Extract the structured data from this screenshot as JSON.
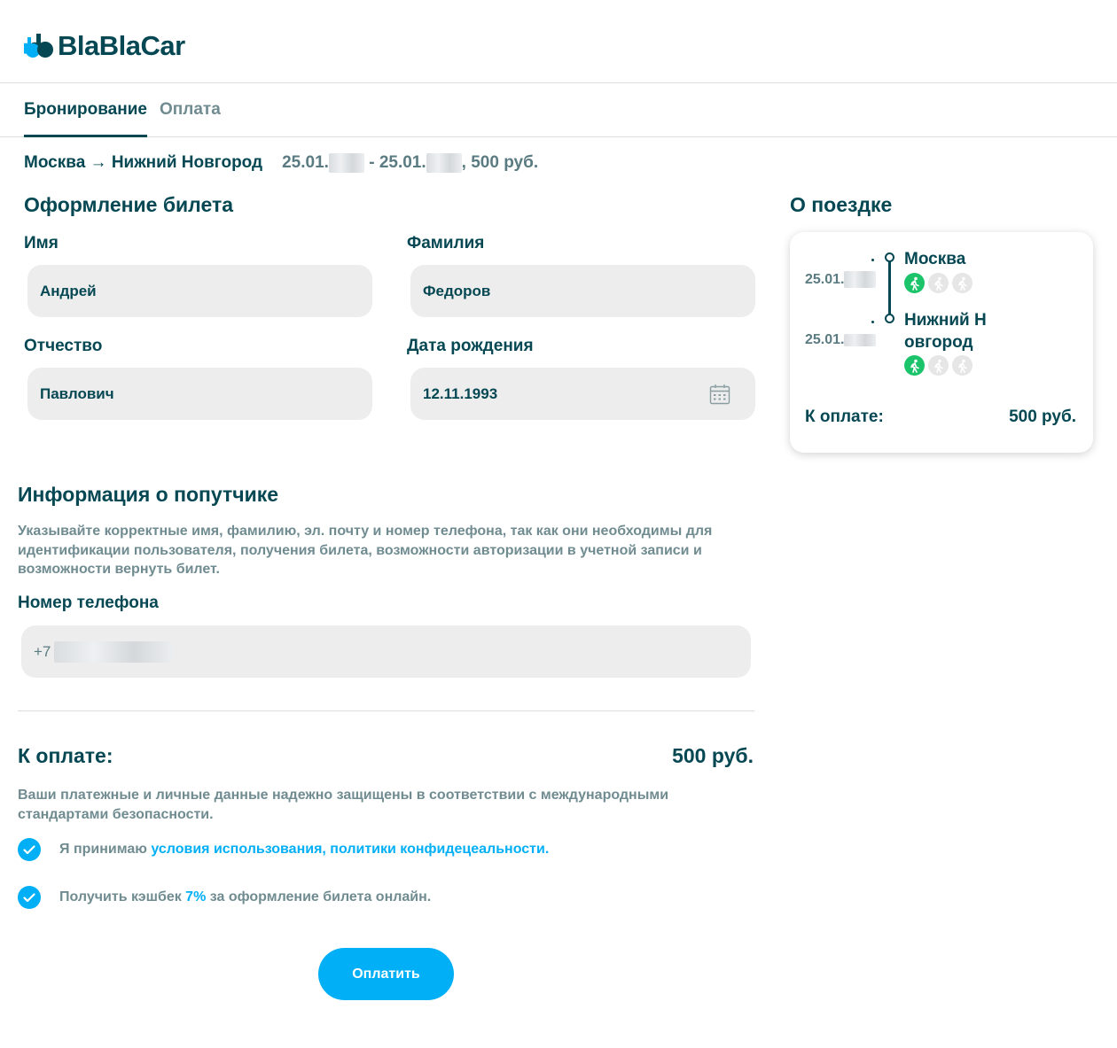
{
  "brand": {
    "name": "BlaBlaCar",
    "color": "#054752",
    "accent": "#00aff5"
  },
  "tabs": [
    {
      "label": "Бронирование",
      "active": true
    },
    {
      "label": "Оплата",
      "active": false
    }
  ],
  "route": {
    "title": "Москва → Нижний Новгород",
    "date_from": "25.01.",
    "date_sep": " - ",
    "date_to": "25.01.",
    "price_suffix": ", 500 руб."
  },
  "ticket_form": {
    "title": "Оформление билета",
    "first_name": {
      "label": "Имя",
      "value": "Андрей"
    },
    "last_name": {
      "label": "Фамилия",
      "value": "Федоров"
    },
    "patronymic": {
      "label": "Отчество",
      "value": "Павлович"
    },
    "birth_date": {
      "label": "Дата рождения",
      "value": "12.11.1993",
      "icon": "calendar-icon"
    }
  },
  "passenger_info": {
    "title": "Информация о попутчике",
    "hint": "Указывайте корректные имя, фамилию, эл. почту и номер телефона, так как они необходимы для идентификации пользователя, получения билета, возможности авторизации в учетной записи и возможности вернуть билет.",
    "phone": {
      "label": "Номер телефона",
      "prefix": "+7"
    }
  },
  "payment": {
    "total_label": "К оплате:",
    "total_value": "500 руб.",
    "security_note": "Ваши платежные и личные данные надежно защищены в соответствии с международными стандартами безопасности.",
    "terms": {
      "prefix": "Я принимаю ",
      "link": "условия использования, политики конфидецеальности.",
      "checked": true
    },
    "cashback": {
      "prefix": "Получить кэшбек ",
      "percent": "7%",
      "suffix": " за оформление билета онлайн.",
      "checked": true
    },
    "pay_button": "Оплатить"
  },
  "trip_card": {
    "title": "О поездке",
    "departure": {
      "date": "25.01.",
      "city": "Москва",
      "amenities": [
        "walk-icon-active",
        "walk-icon-inactive",
        "walk-icon-inactive"
      ]
    },
    "arrival": {
      "date": "25.01.",
      "city_line1": "Нижний Н",
      "city_line2": "овгород",
      "amenities": [
        "walk-icon-active",
        "walk-icon-inactive",
        "walk-icon-inactive"
      ]
    },
    "total_label": "К оплате:",
    "total_value": "500 руб."
  }
}
